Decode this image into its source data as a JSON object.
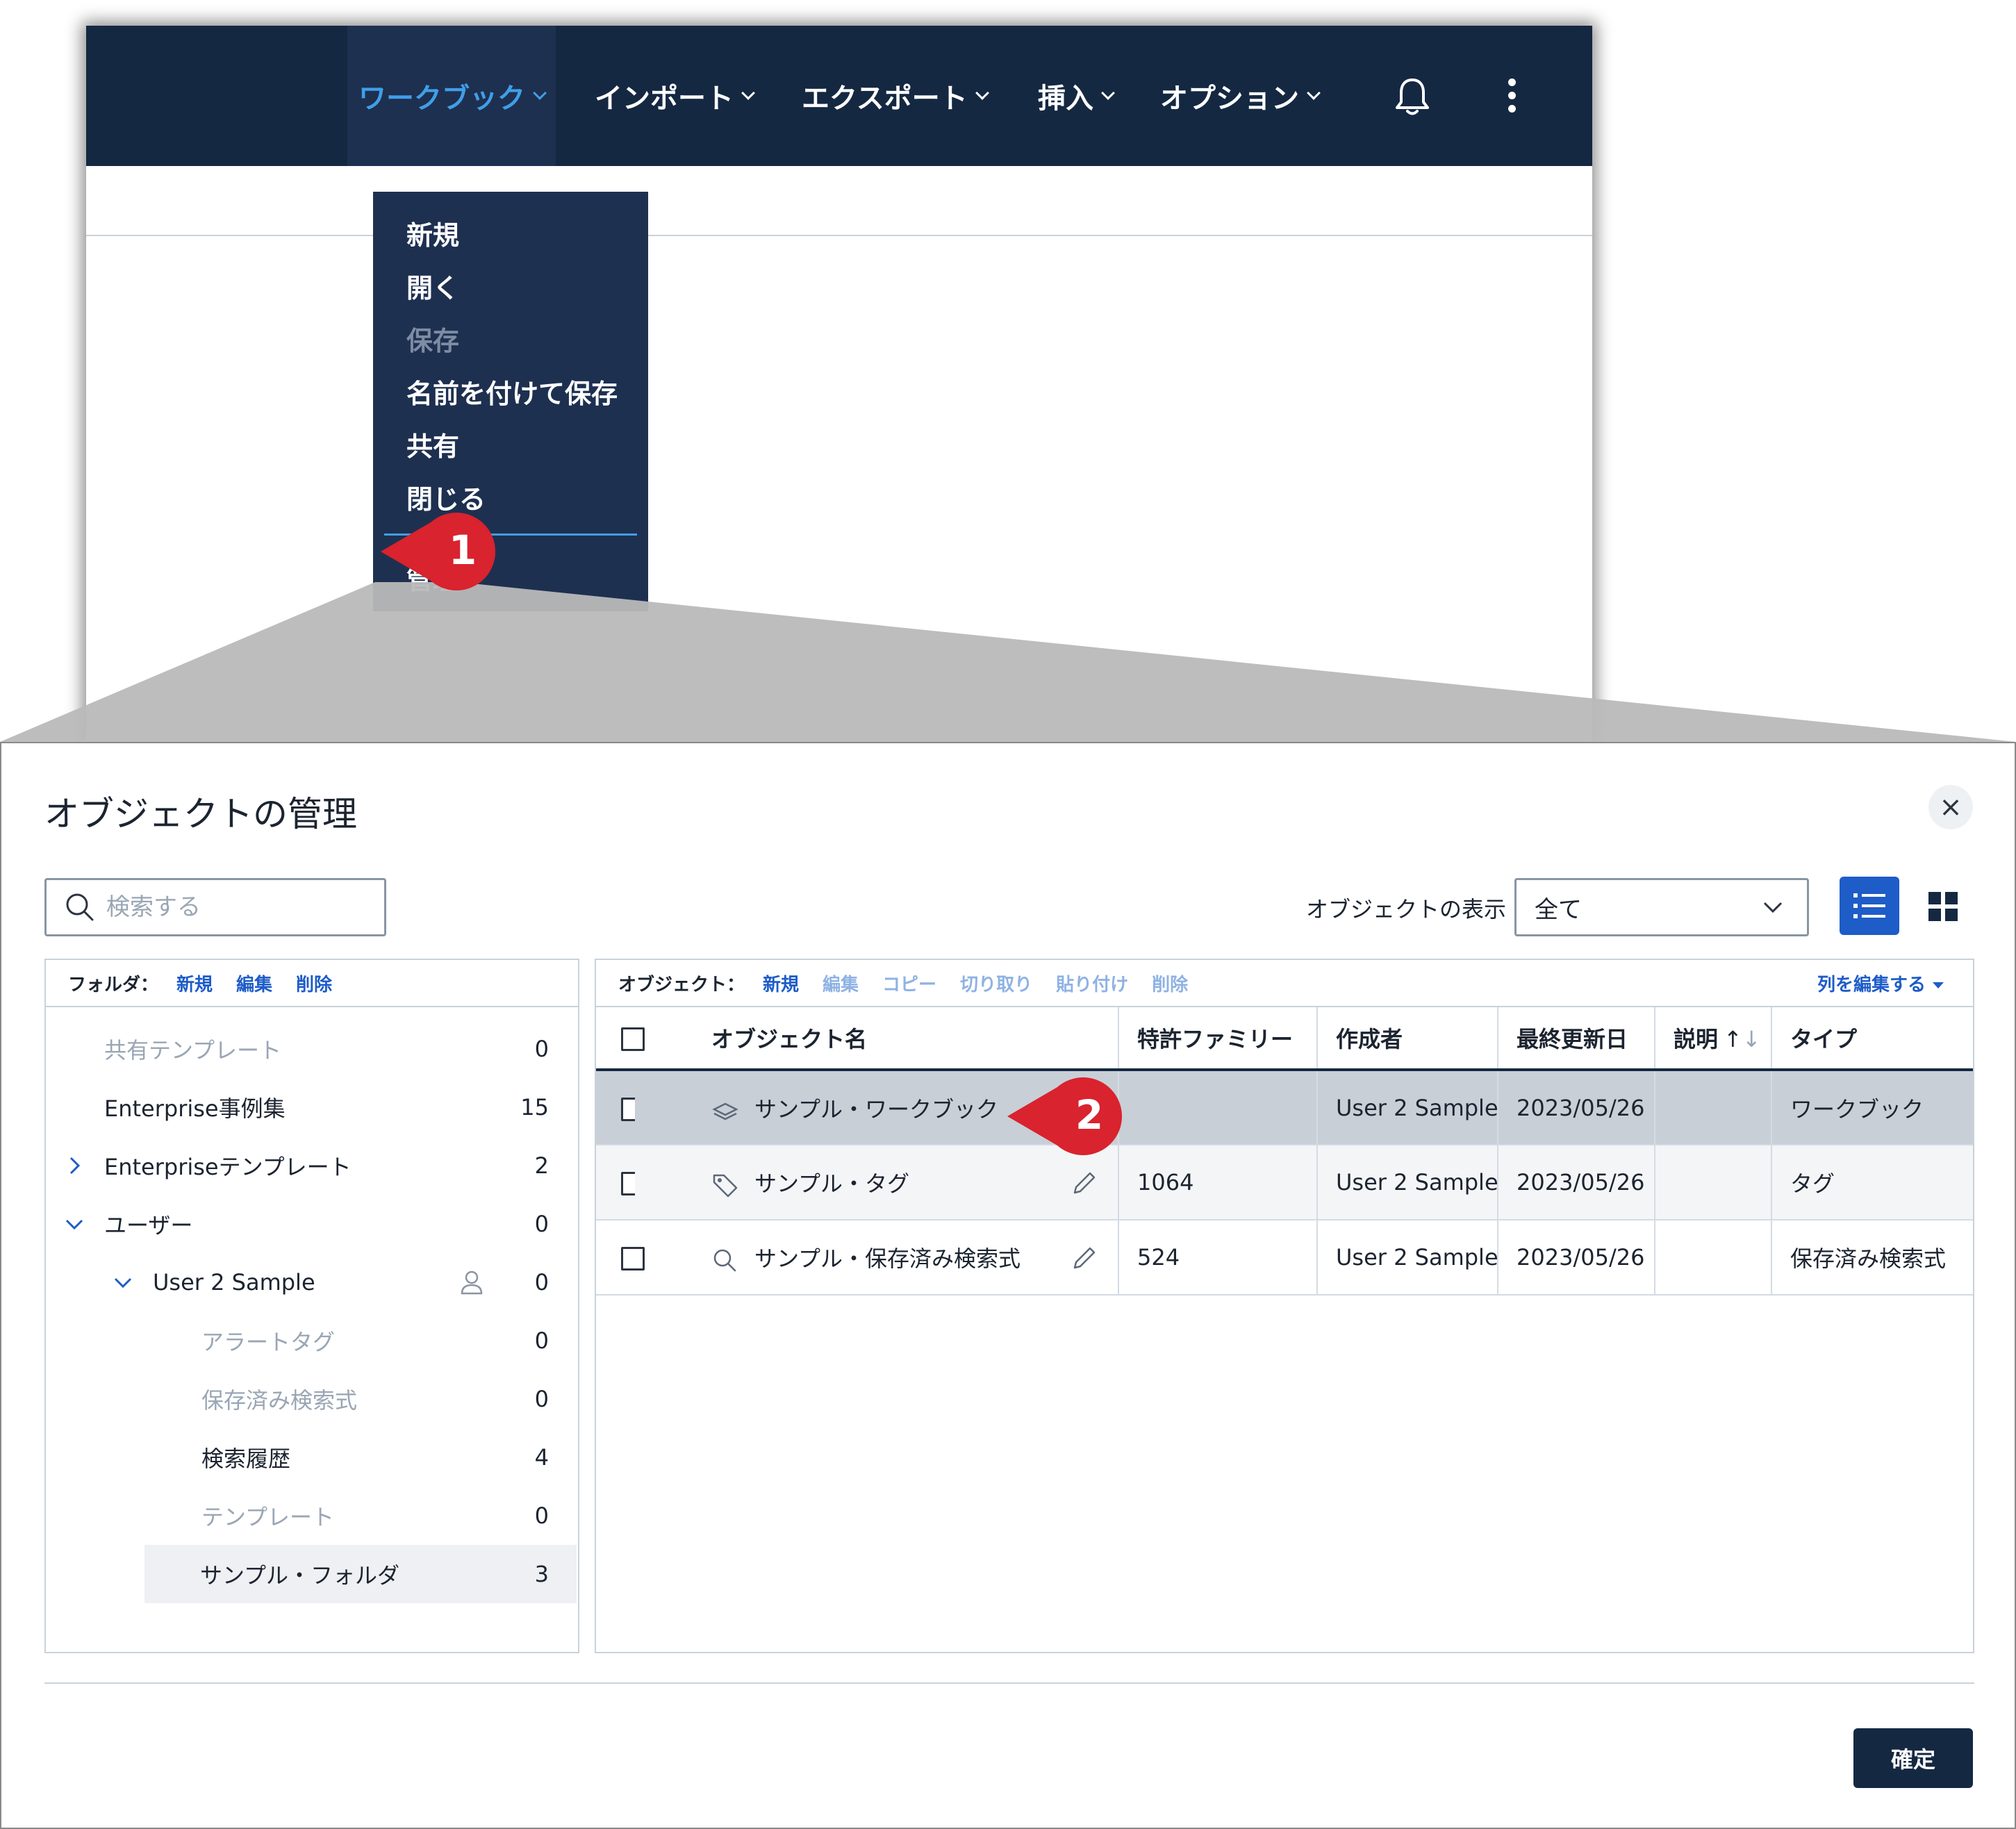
{
  "nav": {
    "workbook": "ワークブック",
    "import": "インポート",
    "export": "エクスポート",
    "insert": "挿入",
    "options": "オプション"
  },
  "workbook_menu": {
    "items": [
      "新規",
      "開く",
      "保存",
      "名前を付けて保存",
      "共有",
      "閉じる"
    ],
    "manage": "管理"
  },
  "callouts": {
    "step1": "1",
    "step2": "2"
  },
  "dialog": {
    "title": "オブジェクトの管理",
    "close": "×",
    "search_placeholder": "検索する",
    "display_label": "オブジェクトの表示",
    "display_value": "全て",
    "confirm": "確定"
  },
  "folder_toolbar": {
    "label": "フォルダ：",
    "new": "新規",
    "edit": "編集",
    "delete": "削除"
  },
  "folders": [
    {
      "label": "共有テンプレート",
      "count": "0"
    },
    {
      "label": "Enterprise事例集",
      "count": "15"
    },
    {
      "label": "Enterpriseテンプレート",
      "count": "2"
    },
    {
      "label": "ユーザー",
      "count": "0"
    },
    {
      "label": "User 2 Sample",
      "count": "0"
    },
    {
      "label": "アラートタグ",
      "count": "0"
    },
    {
      "label": "保存済み検索式",
      "count": "0"
    },
    {
      "label": "検索履歴",
      "count": "4"
    },
    {
      "label": "テンプレート",
      "count": "0"
    },
    {
      "label": "サンプル・フォルダ",
      "count": "3"
    }
  ],
  "object_toolbar": {
    "label": "オブジェクト：",
    "new": "新規",
    "edit": "編集",
    "copy": "コピー",
    "cut": "切り取り",
    "paste": "貼り付け",
    "delete": "削除",
    "edit_columns": "列を編集する"
  },
  "columns": {
    "name": "オブジェクト名",
    "patent_family": "特許ファミリー",
    "author": "作成者",
    "last_updated": "最終更新日",
    "description": "説明",
    "type": "タイプ"
  },
  "rows": [
    {
      "name": "サンプル・ワークブック",
      "patent_family": "",
      "author": "User 2 Sample",
      "last_updated": "2023/05/26",
      "description": "",
      "type": "ワークブック",
      "icon": "workbook-icon"
    },
    {
      "name": "サンプル・タグ",
      "patent_family": "1064",
      "author": "User 2 Sample",
      "last_updated": "2023/05/26",
      "description": "",
      "type": "タグ",
      "icon": "tag-icon"
    },
    {
      "name": "サンプル・保存済み検索式",
      "patent_family": "524",
      "author": "User 2 Sample",
      "last_updated": "2023/05/26",
      "description": "",
      "type": "保存済み検索式",
      "icon": "search-icon"
    }
  ],
  "colors": {
    "navbar": "#152842",
    "menu": "#1e3050",
    "accent": "#3f9fe8",
    "link": "#1e5cc8",
    "callout": "#d9232e"
  }
}
